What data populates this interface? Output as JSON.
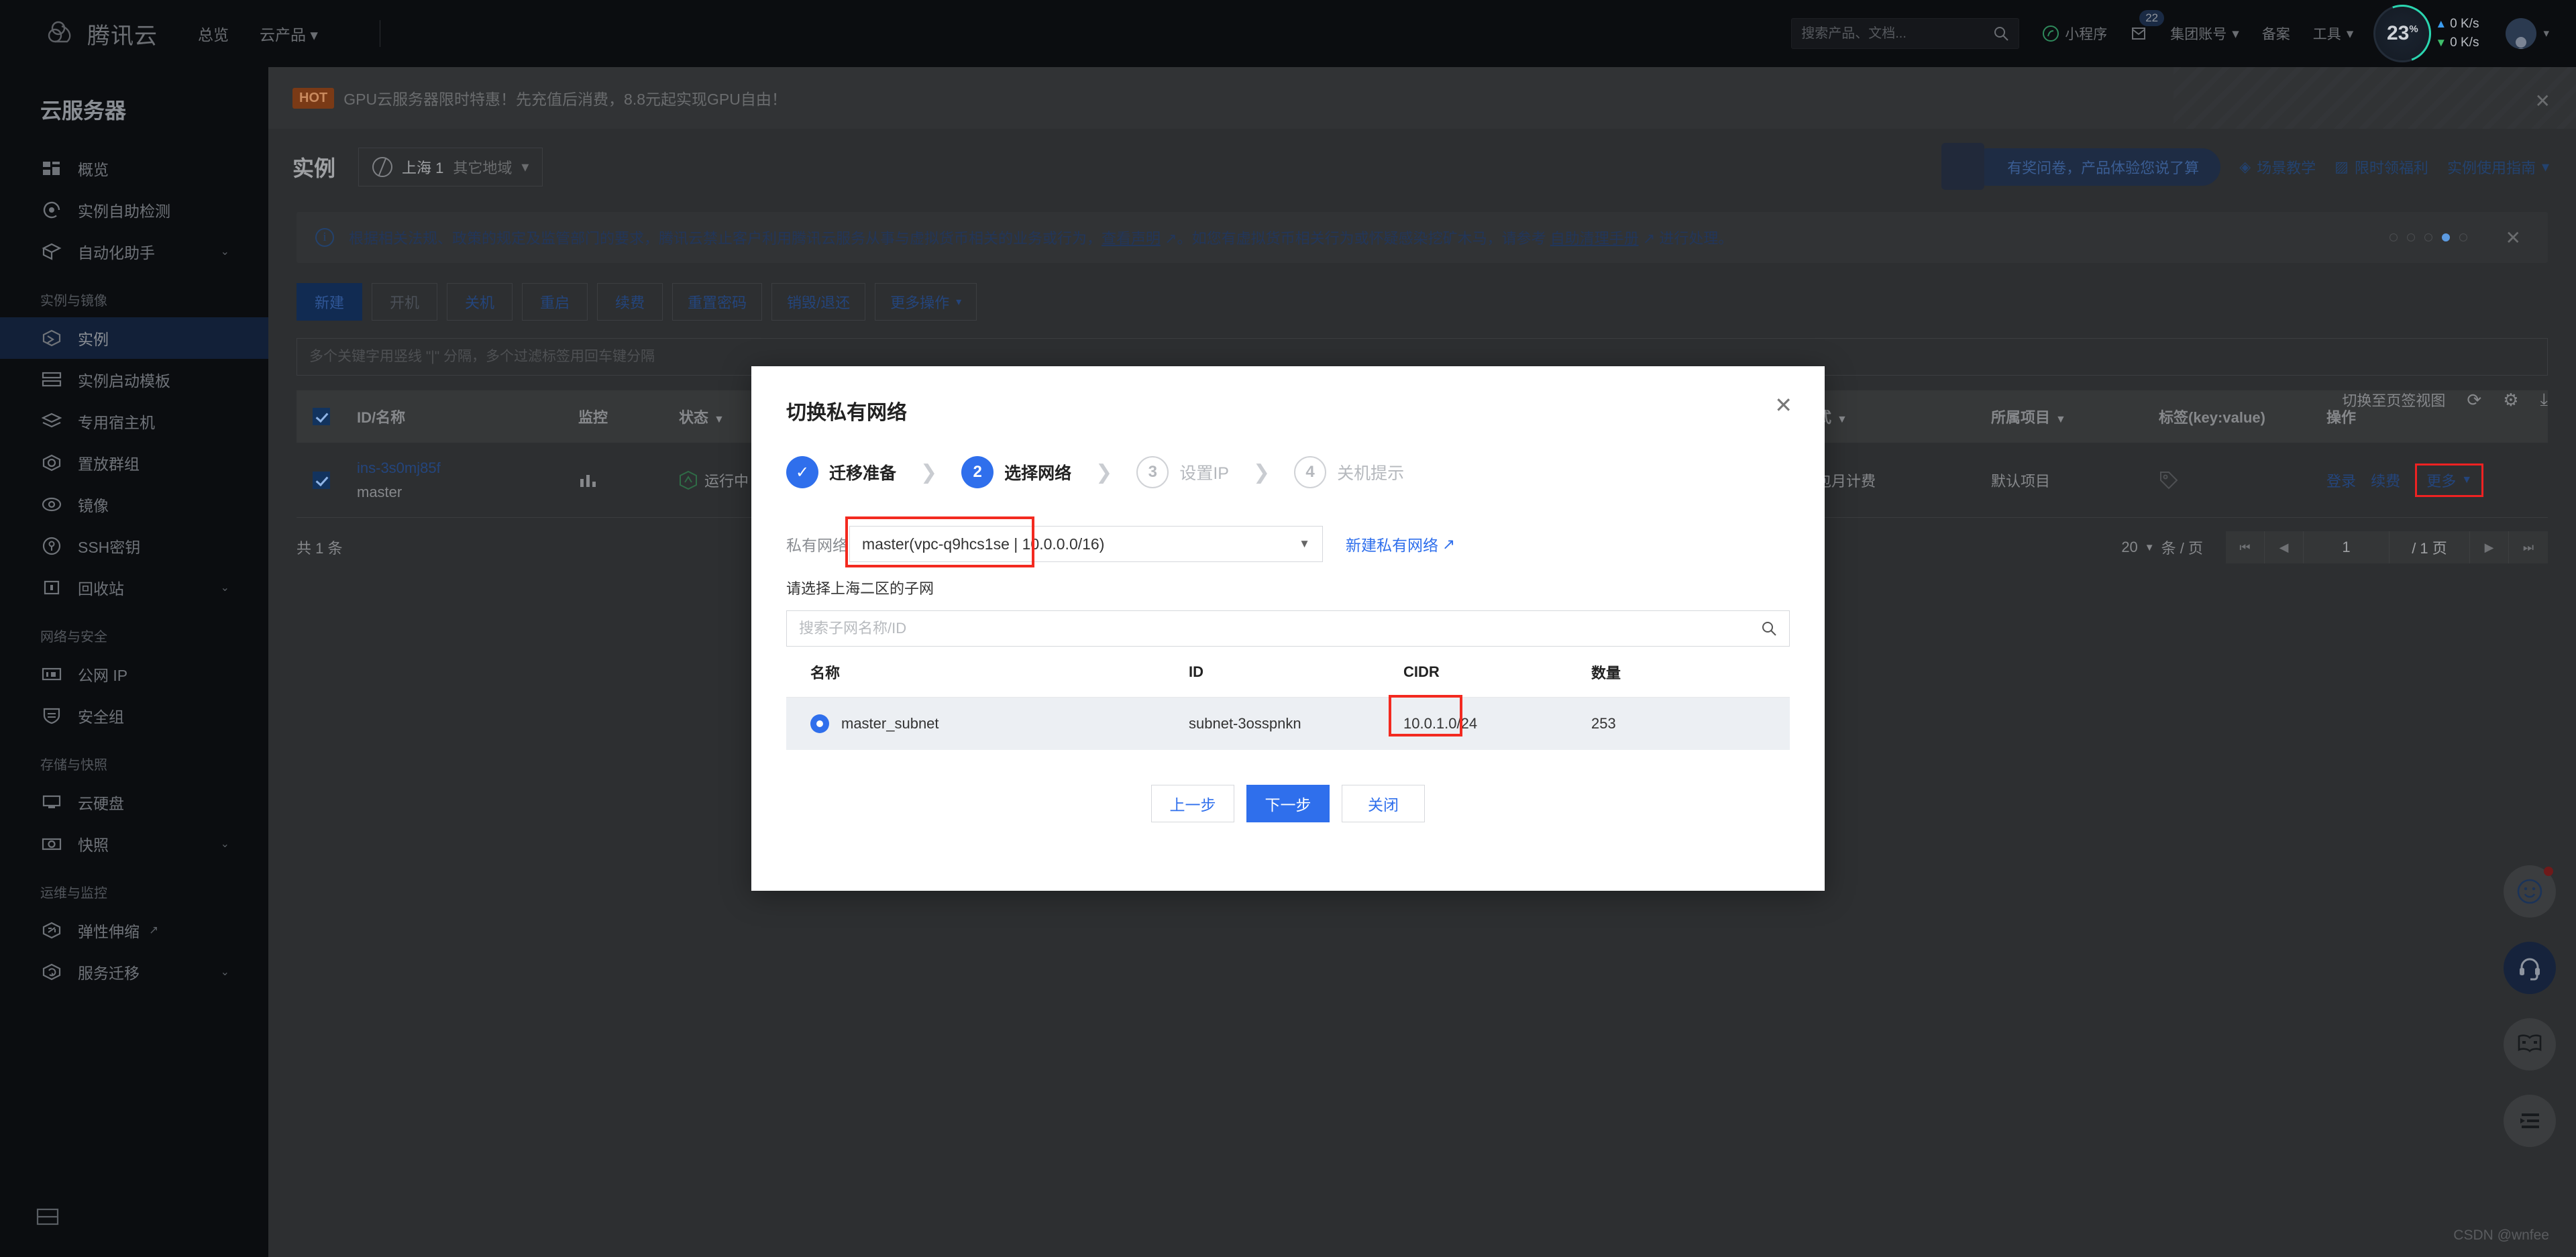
{
  "topnav": {
    "brand": "腾讯云",
    "links": [
      "总览",
      "云产品"
    ],
    "search_placeholder": "搜索产品、文档...",
    "items": [
      {
        "label": "小程序",
        "icon": "miniprogram-icon"
      },
      {
        "label": "",
        "icon": "mail-icon",
        "badge": "22"
      },
      {
        "label": "集团账号",
        "icon": "chevron-down-icon"
      },
      {
        "label": "备案",
        "icon": ""
      },
      {
        "label": "工具",
        "icon": "chevron-down-icon"
      }
    ],
    "cpu_percent": "23",
    "cpu_unit": "%",
    "net_up": "0 K/s",
    "net_down": "0 K/s"
  },
  "sidebar": {
    "title": "云服务器",
    "items": [
      {
        "label": "概览",
        "icon": "dashboard-icon",
        "type": "item"
      },
      {
        "label": "实例自助检测",
        "icon": "detect-icon",
        "type": "item"
      },
      {
        "label": "自动化助手",
        "icon": "automation-icon",
        "type": "item",
        "caret": true
      },
      {
        "label": "实例与镜像",
        "type": "group"
      },
      {
        "label": "实例",
        "icon": "instance-icon",
        "type": "item",
        "active": true
      },
      {
        "label": "实例启动模板",
        "icon": "template-icon",
        "type": "item"
      },
      {
        "label": "专用宿主机",
        "icon": "host-icon",
        "type": "item"
      },
      {
        "label": "置放群组",
        "icon": "placement-icon",
        "type": "item"
      },
      {
        "label": "镜像",
        "icon": "image-icon",
        "type": "item"
      },
      {
        "label": "SSH密钥",
        "icon": "key-icon",
        "type": "item"
      },
      {
        "label": "回收站",
        "icon": "recycle-icon",
        "type": "item",
        "caret": true
      },
      {
        "label": "网络与安全",
        "type": "group"
      },
      {
        "label": "公网 IP",
        "icon": "ip-icon",
        "type": "item"
      },
      {
        "label": "安全组",
        "icon": "shield-icon",
        "type": "item"
      },
      {
        "label": "存储与快照",
        "type": "group"
      },
      {
        "label": "云硬盘",
        "icon": "disk-icon",
        "type": "item"
      },
      {
        "label": "快照",
        "icon": "camera-icon",
        "type": "item",
        "caret": true
      },
      {
        "label": "运维与监控",
        "type": "group"
      },
      {
        "label": "弹性伸缩",
        "icon": "scale-icon",
        "type": "item",
        "external": true
      },
      {
        "label": "服务迁移",
        "icon": "migrate-icon",
        "type": "item",
        "caret": true
      }
    ]
  },
  "hot_banner": {
    "tag": "HOT",
    "text": "GPU云服务器限时特惠！先充值后消费，8.8元起实现GPU自由！"
  },
  "page_head": {
    "title": "实例",
    "region": "上海 1",
    "region_other": "其它地域",
    "survey": "有奖问卷，产品体验您说了算",
    "links": [
      "场景教学",
      "限时领福利",
      "实例使用指南"
    ]
  },
  "notice": {
    "text_a": "根据相关法规、政策的规定及监管部门的要求，腾讯云禁止客户利用腾讯云服务从事与虚拟货币相关的业务或行为，",
    "link_a": "查看声明",
    "text_b": "。如您有虚拟货币相关行为或怀疑感染挖矿木马，请参考 ",
    "link_b": "自助清理手册",
    "text_c": " 进行处理。"
  },
  "toolbar": {
    "buttons": [
      {
        "label": "新建",
        "style": "primary"
      },
      {
        "label": "开机",
        "style": "disabled"
      },
      {
        "label": "关机",
        "style": "normal"
      },
      {
        "label": "重启",
        "style": "normal"
      },
      {
        "label": "续费",
        "style": "normal"
      },
      {
        "label": "重置密码",
        "style": "normal"
      },
      {
        "label": "销毁/退还",
        "style": "normal"
      },
      {
        "label": "更多操作",
        "style": "normal",
        "caret": true
      }
    ],
    "search_placeholder": "多个关键字用竖线 \"|\" 分隔，多个过滤标签用回车键分隔"
  },
  "view_switch": {
    "label": "切换至页签视图"
  },
  "table": {
    "headers": [
      "ID/名称",
      "监控",
      "状态",
      "网络计费模式",
      "所属项目",
      "标签(key:value)",
      "操作"
    ],
    "rows": [
      {
        "id": "ins-3s0mj85f",
        "name": "master",
        "state": "运行中",
        "billing": "按带宽包年包月计费",
        "project": "默认项目",
        "tag": "",
        "actions": [
          "登录",
          "续费",
          "更多"
        ]
      }
    ],
    "total": "共 1 条",
    "page_size": "20",
    "page_size_unit": "条 / 页",
    "page_current": "1",
    "page_total": "/ 1 页"
  },
  "modal": {
    "title": "切换私有网络",
    "steps": [
      {
        "num": "✓",
        "label": "迁移准备",
        "state": "done"
      },
      {
        "num": "2",
        "label": "选择网络",
        "state": "current"
      },
      {
        "num": "3",
        "label": "设置IP",
        "state": "todo"
      },
      {
        "num": "4",
        "label": "关机提示",
        "state": "todo"
      }
    ],
    "vpc_label": "私有网络",
    "vpc_value": "master(vpc-q9hcs1se | 10.0.0.0/16)",
    "vpc_new_link": "新建私有网络",
    "subnet_hint": "请选择上海二区的子网",
    "subnet_search_placeholder": "搜索子网名称/ID",
    "subnet_headers": [
      "名称",
      "ID",
      "CIDR",
      "数量"
    ],
    "subnet_rows": [
      {
        "name": "master_subnet",
        "id": "subnet-3osspnkn",
        "cidr": "10.0.1.0/24",
        "count": "253",
        "selected": true
      }
    ],
    "buttons": [
      {
        "label": "上一步",
        "style": "ghost"
      },
      {
        "label": "下一步",
        "style": "solid"
      },
      {
        "label": "关闭",
        "style": "ghost"
      }
    ]
  },
  "floating": {
    "items": [
      "smiley-icon",
      "headset-icon",
      "book-icon",
      "list-icon"
    ]
  },
  "watermark": "CSDN @wnfee",
  "colors": {
    "accent": "#2f6fec",
    "highlight_red": "#f32a20",
    "hot_tag": "#7a3a16"
  }
}
